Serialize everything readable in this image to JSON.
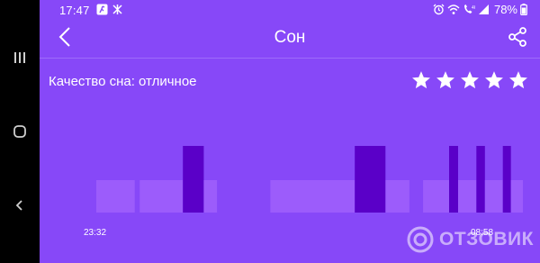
{
  "status_bar": {
    "time": "17:47",
    "battery": "78%"
  },
  "app_bar": {
    "title": "Сон"
  },
  "sleep": {
    "quality_label": "Качество сна: отличное",
    "stars_count": 5,
    "stars_max": 5,
    "time_start": "23:32",
    "time_end": "08:58"
  },
  "chart_data": {
    "type": "bar",
    "x_start": "23:32",
    "x_end": "08:58",
    "legend": "none",
    "grid": false,
    "levels": [
      "light",
      "deep"
    ],
    "colors": {
      "light": "#9C5CFB",
      "deep": "#5A00C8"
    },
    "segments": [
      {
        "start": 0.0,
        "end": 0.09,
        "level": "light"
      },
      {
        "start": 0.102,
        "end": 0.203,
        "level": "light"
      },
      {
        "start": 0.203,
        "end": 0.252,
        "level": "deep"
      },
      {
        "start": 0.252,
        "end": 0.283,
        "level": "light"
      },
      {
        "start": 0.408,
        "end": 0.606,
        "level": "light"
      },
      {
        "start": 0.606,
        "end": 0.678,
        "level": "deep"
      },
      {
        "start": 0.678,
        "end": 0.734,
        "level": "light"
      },
      {
        "start": 0.766,
        "end": 0.827,
        "level": "light"
      },
      {
        "start": 0.827,
        "end": 0.848,
        "level": "deep"
      },
      {
        "start": 0.848,
        "end": 0.891,
        "level": "light"
      },
      {
        "start": 0.891,
        "end": 0.911,
        "level": "deep"
      },
      {
        "start": 0.911,
        "end": 0.953,
        "level": "light"
      },
      {
        "start": 0.953,
        "end": 0.972,
        "level": "deep"
      },
      {
        "start": 0.972,
        "end": 1.0,
        "level": "light"
      }
    ]
  },
  "watermark": {
    "text": "ОТЗОВИК"
  },
  "icons": {
    "nav_recent": "recent-apps-icon",
    "nav_home": "home-icon",
    "nav_back": "system-back-icon",
    "back": "back-arrow-icon",
    "share": "share-icon",
    "star": "star-icon"
  }
}
